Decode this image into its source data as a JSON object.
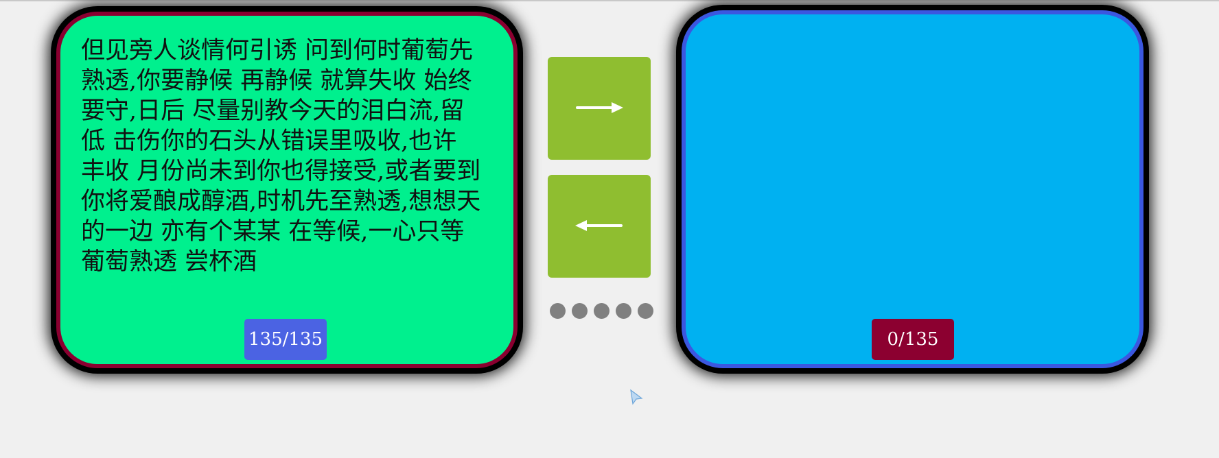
{
  "source_panel": {
    "lyrics": "但见旁人谈情何引诱 问到何时葡萄先熟透,你要静候 再静候 就算失收 始终要守,日后 尽量别教今天的泪白流,留低 击伤你的石头从错误里吸收,也许 丰收 月份尚未到你也得接受,或者要到你将爱酿成醇酒,时机先至熟透,想想天的一边 亦有个某某 在等候,一心只等葡萄熟透 尝杯酒",
    "counter": "135/135"
  },
  "target_panel": {
    "lyrics": "",
    "counter": "0/135"
  },
  "controls": {
    "move_right_icon": "arrow-right-icon",
    "move_left_icon": "arrow-left-icon",
    "dot_count": 5
  },
  "colors": {
    "source_bg": "#00f08e",
    "source_border": "#8a0030",
    "target_bg": "#00b1f1",
    "target_border": "#3b57e0",
    "button_bg": "#8fbe30",
    "source_counter_bg": "#4b63e3",
    "target_counter_bg": "#8c0030",
    "dot": "#808080"
  }
}
